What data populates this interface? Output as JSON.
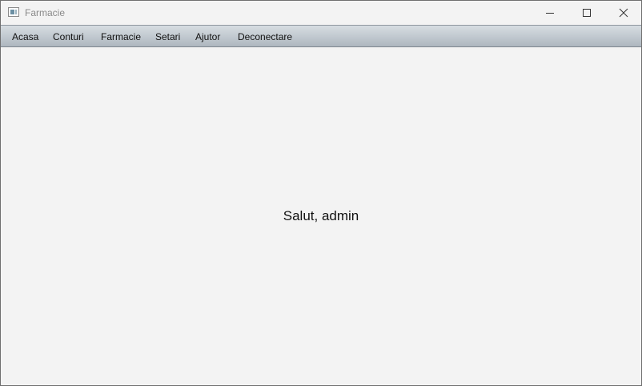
{
  "window": {
    "title": "Farmacie",
    "icon": "app-window-icon",
    "controls": {
      "minimize_icon": "minimize-icon",
      "maximize_icon": "maximize-icon",
      "close_icon": "close-icon"
    }
  },
  "menu": {
    "items": [
      {
        "label": "Acasa"
      },
      {
        "label": "Conturi"
      },
      {
        "label": "Farmacie"
      },
      {
        "label": "Setari"
      },
      {
        "label": "Ajutor"
      },
      {
        "label": "Deconectare"
      }
    ]
  },
  "main": {
    "greeting": "Salut, admin"
  },
  "colors": {
    "background": "#f3f3f3",
    "menubar_top": "#d7dde2",
    "menubar_bottom": "#aeb7bf",
    "text": "#111111",
    "title_text": "#8a8a8a"
  }
}
